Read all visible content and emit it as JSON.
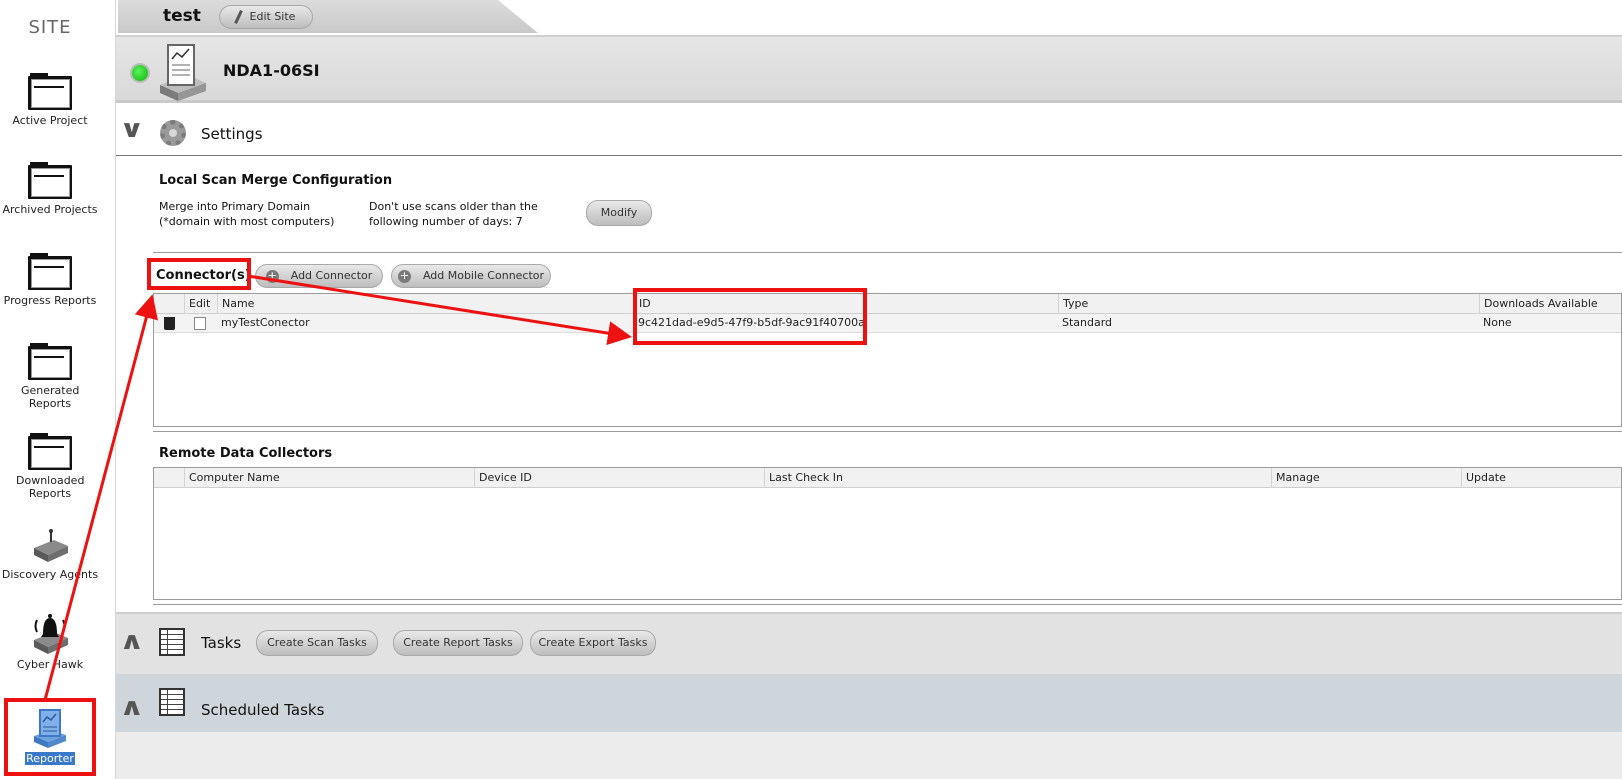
{
  "sidebar": {
    "header": "SITE",
    "items": [
      {
        "label": "Active Project"
      },
      {
        "label": "Archived Projects"
      },
      {
        "label": "Progress Reports"
      },
      {
        "label": "Generated Reports"
      },
      {
        "label": "Downloaded Reports"
      },
      {
        "label": "Discovery Agents"
      },
      {
        "label": "Cyber Hawk"
      },
      {
        "label": "Reporter",
        "selected": true
      }
    ]
  },
  "site": {
    "name": "test",
    "edit_label": "Edit Site"
  },
  "device": {
    "name": "NDA1-06SI",
    "status_color": "#19c419"
  },
  "settings": {
    "title": "Settings",
    "merge": {
      "title": "Local Scan Merge Configuration",
      "line1": "Merge into Primary Domain",
      "line2": "(*domain with most computers)",
      "age_line1": "Don't use scans older than the",
      "age_line2": "following number of days: 7",
      "modify_label": "Modify"
    },
    "connectors": {
      "title": "Connector(s)",
      "add_label": "Add Connector",
      "add_mobile_label": "Add Mobile Connector",
      "columns": [
        "Edit",
        "Name",
        "ID",
        "Type",
        "Downloads Available"
      ],
      "rows": [
        {
          "name": "myTestConector",
          "id": "9c421dad-e9d5-47f9-b5df-9ac91f40700a",
          "type": "Standard",
          "downloads": "None"
        }
      ]
    },
    "collectors": {
      "title": "Remote Data Collectors",
      "columns": [
        "Computer Name",
        "Device ID",
        "Last Check In",
        "Manage",
        "Update"
      ]
    }
  },
  "tasks": {
    "title": "Tasks",
    "buttons": [
      "Create Scan Tasks",
      "Create Report Tasks",
      "Create Export Tasks"
    ]
  },
  "scheduled": {
    "title": "Scheduled Tasks"
  },
  "annotation_color": "#ee1111"
}
